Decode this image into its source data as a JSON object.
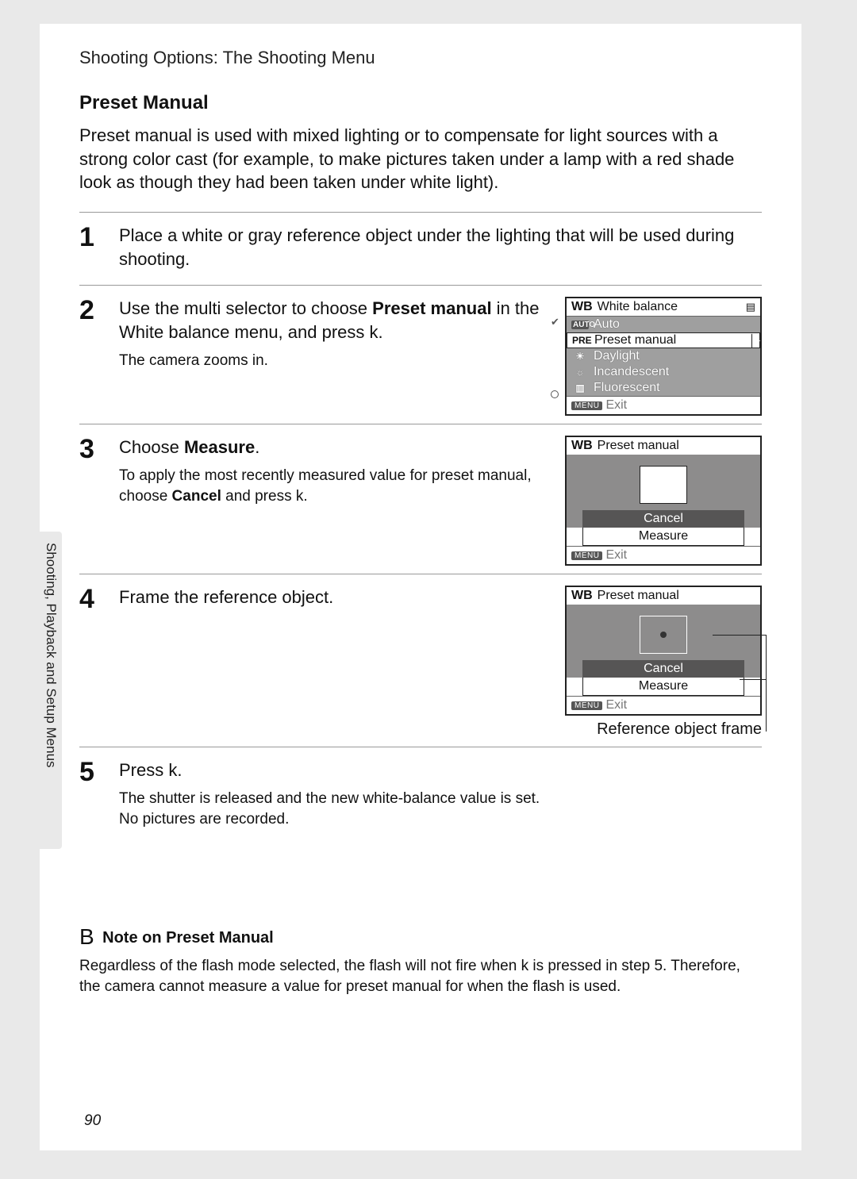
{
  "breadcrumb": "Shooting Options: The Shooting Menu",
  "side_label": "Shooting, Playback and Setup Menus",
  "section_heading": "Preset Manual",
  "intro": "Preset manual is used with mixed lighting or to compensate for light sources with a strong color cast (for example, to make pictures taken under a lamp with a red shade look as though they had been taken under white light).",
  "steps": {
    "s1": {
      "num": "1",
      "title_a": "Place a white or gray reference object ",
      "title_b": "under the lighting that will be used during shooting."
    },
    "s2": {
      "num": "2",
      "title_a": "Use the multi selector to choose ",
      "title_b_bold": "Preset manual",
      "title_c": " in the White balance menu, and press ",
      "title_k": "k",
      "title_d": ".",
      "note": "The camera zooms in."
    },
    "s3": {
      "num": "3",
      "title_a": "Choose ",
      "title_b_bold": "Measure",
      "title_c": ".",
      "note_a": "To apply the most recently measured value for preset manual, choose ",
      "note_bold": "Cancel",
      "note_b": " and press ",
      "note_k": "k",
      "note_c": "."
    },
    "s4": {
      "num": "4",
      "title": "Frame the reference object.",
      "caption": "Reference object frame"
    },
    "s5": {
      "num": "5",
      "title_a": "Press ",
      "title_k": "k",
      "title_b": ".",
      "note_a": "The shutter is released and the new white-balance value is set.",
      "note_b": "No pictures are recorded."
    }
  },
  "lcd_wb": {
    "wb_icon": "WB",
    "title": "White balance",
    "menu_icon": "▤",
    "rows": {
      "auto_icon": "AUTO",
      "auto": "Auto",
      "pre_icon": "PRE",
      "pre": "Preset manual",
      "day_icon": "☀",
      "day": "Daylight",
      "inc_icon": "☼",
      "inc": "Incandescent",
      "flu_icon": "▥",
      "flu": "Fluorescent"
    },
    "footer_menu": "MENU",
    "footer_exit": "Exit"
  },
  "lcd_pm": {
    "wb_icon": "WB",
    "title": "Preset manual",
    "cancel": "Cancel",
    "measure": "Measure",
    "footer_menu": "MENU",
    "footer_exit": "Exit"
  },
  "lcd_rf": {
    "wb_icon": "WB",
    "title": "Preset manual",
    "cancel": "Cancel",
    "measure": "Measure",
    "footer_menu": "MENU",
    "footer_exit": "Exit"
  },
  "note": {
    "letter": "B",
    "heading": "Note on Preset Manual",
    "text_a": "Regardless of the flash mode selected, the flash will not fire when ",
    "text_k": "k",
    "text_b": " is pressed in step 5. Therefore, the camera cannot measure a value for preset manual for when the flash is used."
  },
  "page_number": "90"
}
